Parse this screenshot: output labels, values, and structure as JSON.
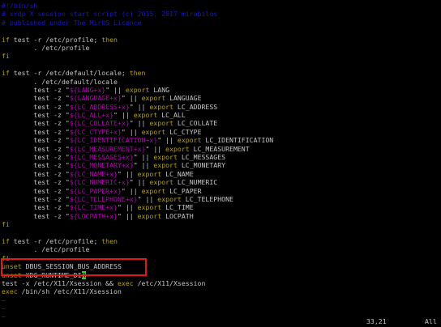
{
  "lines": [
    {
      "k": "comment",
      "t": "#!/bin/sh"
    },
    {
      "k": "comment",
      "t": "# xrdp X session start script (c) 2015, 2017 mirabilos"
    },
    {
      "k": "comment",
      "t": "# published under The MirOS Licence"
    },
    {
      "k": "blank",
      "t": ""
    },
    {
      "k": "plain",
      "t": "if test -r /etc/profile; then"
    },
    {
      "k": "plain",
      "t": "        . /etc/profile"
    },
    {
      "k": "plain",
      "t": "fi"
    },
    {
      "k": "blank",
      "t": ""
    },
    {
      "k": "plain",
      "t": "if test -r /etc/default/locale; then"
    },
    {
      "k": "plain",
      "t": "        . /etc/default/locale"
    },
    {
      "k": "plain",
      "t": "        test -z \"${LANG+x}\" || export LANG"
    },
    {
      "k": "plain",
      "t": "        test -z \"${LANGUAGE+x}\" || export LANGUAGE"
    },
    {
      "k": "plain",
      "t": "        test -z \"${LC_ADDRESS+x}\" || export LC_ADDRESS"
    },
    {
      "k": "plain",
      "t": "        test -z \"${LC_ALL+x}\" || export LC_ALL"
    },
    {
      "k": "plain",
      "t": "        test -z \"${LC_COLLATE+x}\" || export LC_COLLATE"
    },
    {
      "k": "plain",
      "t": "        test -z \"${LC_CTYPE+x}\" || export LC_CTYPE"
    },
    {
      "k": "plain",
      "t": "        test -z \"${LC_IDENTIFICATION+x}\" || export LC_IDENTIFICATION"
    },
    {
      "k": "plain",
      "t": "        test -z \"${LC_MEASUREMENT+x}\" || export LC_MEASUREMENT"
    },
    {
      "k": "plain",
      "t": "        test -z \"${LC_MESSAGES+x}\" || export LC_MESSAGES"
    },
    {
      "k": "plain",
      "t": "        test -z \"${LC_MONETARY+x}\" || export LC_MONETARY"
    },
    {
      "k": "plain",
      "t": "        test -z \"${LC_NAME+x}\" || export LC_NAME"
    },
    {
      "k": "plain",
      "t": "        test -z \"${LC_NUMERIC+x}\" || export LC_NUMERIC"
    },
    {
      "k": "plain",
      "t": "        test -z \"${LC_PAPER+x}\" || export LC_PAPER"
    },
    {
      "k": "plain",
      "t": "        test -z \"${LC_TELEPHONE+x}\" || export LC_TELEPHONE"
    },
    {
      "k": "plain",
      "t": "        test -z \"${LC_TIME+x}\" || export LC_TIME"
    },
    {
      "k": "plain",
      "t": "        test -z \"${LOCPATH+x}\" || export LOCPATH"
    },
    {
      "k": "plain",
      "t": "fi"
    },
    {
      "k": "blank",
      "t": ""
    },
    {
      "k": "plain",
      "t": "if test -r /etc/profile; then"
    },
    {
      "k": "plain",
      "t": "        . /etc/profile"
    },
    {
      "k": "plain",
      "t": "fi"
    },
    {
      "k": "plain",
      "t": "unset DBUS_SESSION_BUS_ADDRESS"
    },
    {
      "k": "plain",
      "t": "unset XDG_RUNTIME_DIR"
    },
    {
      "k": "plain",
      "t": "test -x /etc/X11/Xsession && exec /etc/X11/Xsession"
    },
    {
      "k": "plain",
      "t": "exec /bin/sh /etc/X11/Xsession"
    },
    {
      "k": "tilde",
      "t": "~"
    },
    {
      "k": "tilde",
      "t": "~"
    },
    {
      "k": "tilde",
      "t": "~"
    }
  ],
  "status": {
    "position": "33,21",
    "scroll": "All"
  },
  "colors": {
    "comment": "#1818c8",
    "keyword": "#b7a200",
    "variable": "#b400b4",
    "cursor": "#39c839",
    "highlight": "#e01818"
  }
}
